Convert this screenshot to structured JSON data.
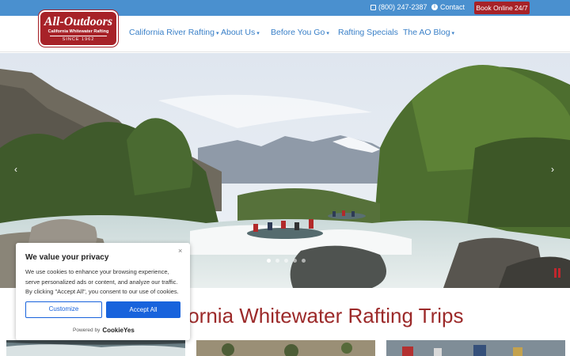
{
  "topbar": {
    "phone": "(800) 247-2387",
    "contact": "Contact",
    "book_online": "Book Online 24/7"
  },
  "logo": {
    "title": "All-Outdoors",
    "subtitle": "California Whitewater Rafting",
    "since": "SINCE 1962"
  },
  "nav": {
    "items": [
      {
        "label": "California River Rafting",
        "has_dropdown": true
      },
      {
        "label": "About Us",
        "has_dropdown": true
      },
      {
        "label": "Before You Go",
        "has_dropdown": true
      },
      {
        "label": "Rafting Specials",
        "has_dropdown": false
      },
      {
        "label": "The AO Blog",
        "has_dropdown": true
      }
    ]
  },
  "hero": {
    "prev_icon": "chevron-left-icon",
    "next_icon": "chevron-right-icon",
    "prev": "‹",
    "next": "›",
    "slide_count": 5,
    "active_slide": 1
  },
  "section": {
    "title": "fornia Whitewater Rafting Trips"
  },
  "cookie": {
    "title": "We value your privacy",
    "body": "We use cookies to enhance your browsing experience, serve personalized ads or content, and analyze our traffic. By clicking \"Accept All\", you consent to our use of cookies.",
    "customize": "Customize",
    "accept_all": "Accept All",
    "powered_by": "Powered by",
    "powered_brand": "CookieYes",
    "close": "×"
  },
  "colors": {
    "topbar": "#4a90cf",
    "brand_red": "#a72228",
    "nav_link": "#3a80c8",
    "title_red": "#9c2a2a",
    "cookie_blue": "#1863dc"
  }
}
